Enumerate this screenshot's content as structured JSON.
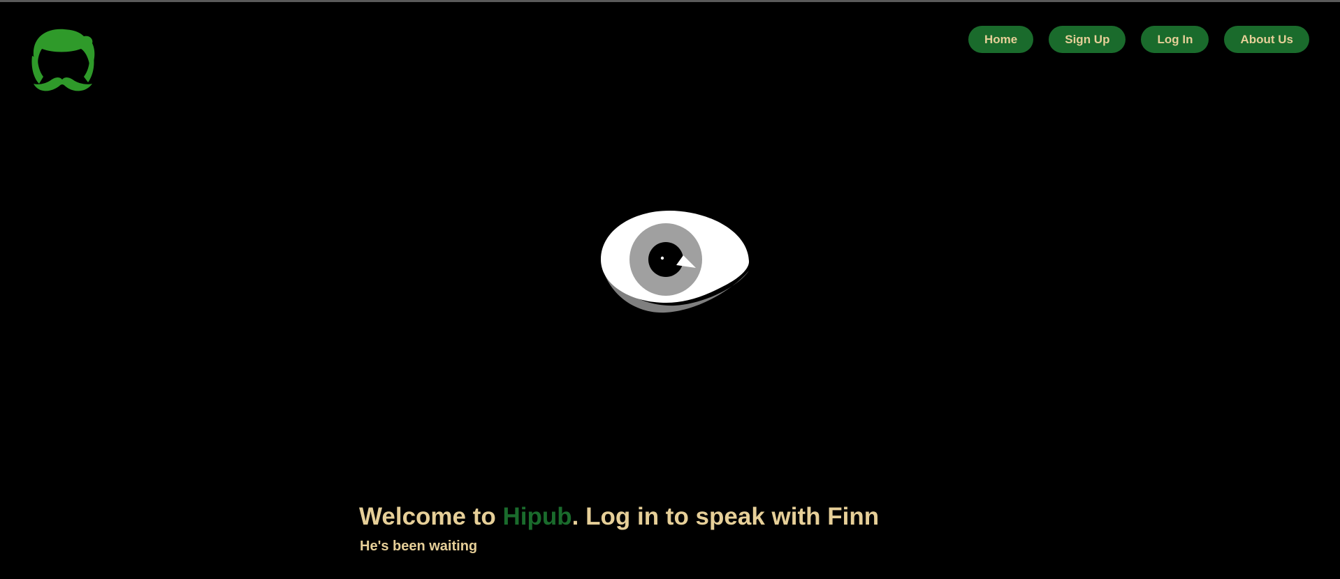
{
  "logo": {
    "icon": "hipster-head-mustache-icon",
    "color": "#2f9a2a"
  },
  "nav": {
    "home_label": "Home",
    "signup_label": "Sign Up",
    "login_label": "Log In",
    "about_label": "About Us"
  },
  "hero": {
    "icon": "eye-icon",
    "welcome_prefix": "Welcome to ",
    "brand": "Hipub",
    "welcome_suffix": ". Log in to speak with Finn",
    "subtitle": "He's been waiting"
  },
  "colors": {
    "background": "#000000",
    "accent_green": "#1a6b2c",
    "text_tan": "#e6cf98"
  }
}
